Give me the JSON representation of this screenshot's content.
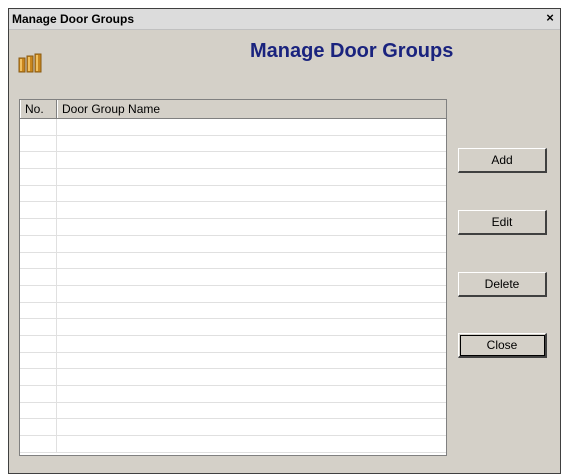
{
  "window": {
    "title": "Manage Door Groups",
    "close_glyph": "×"
  },
  "header": {
    "heading": "Manage Door Groups",
    "logo_icon": "door-group-icon",
    "heading_color": "#1a237e"
  },
  "grid": {
    "columns": [
      "No.",
      "Door Group Name"
    ],
    "rows": []
  },
  "buttons": {
    "add": "Add",
    "edit": "Edit",
    "delete": "Delete",
    "close": "Close"
  }
}
